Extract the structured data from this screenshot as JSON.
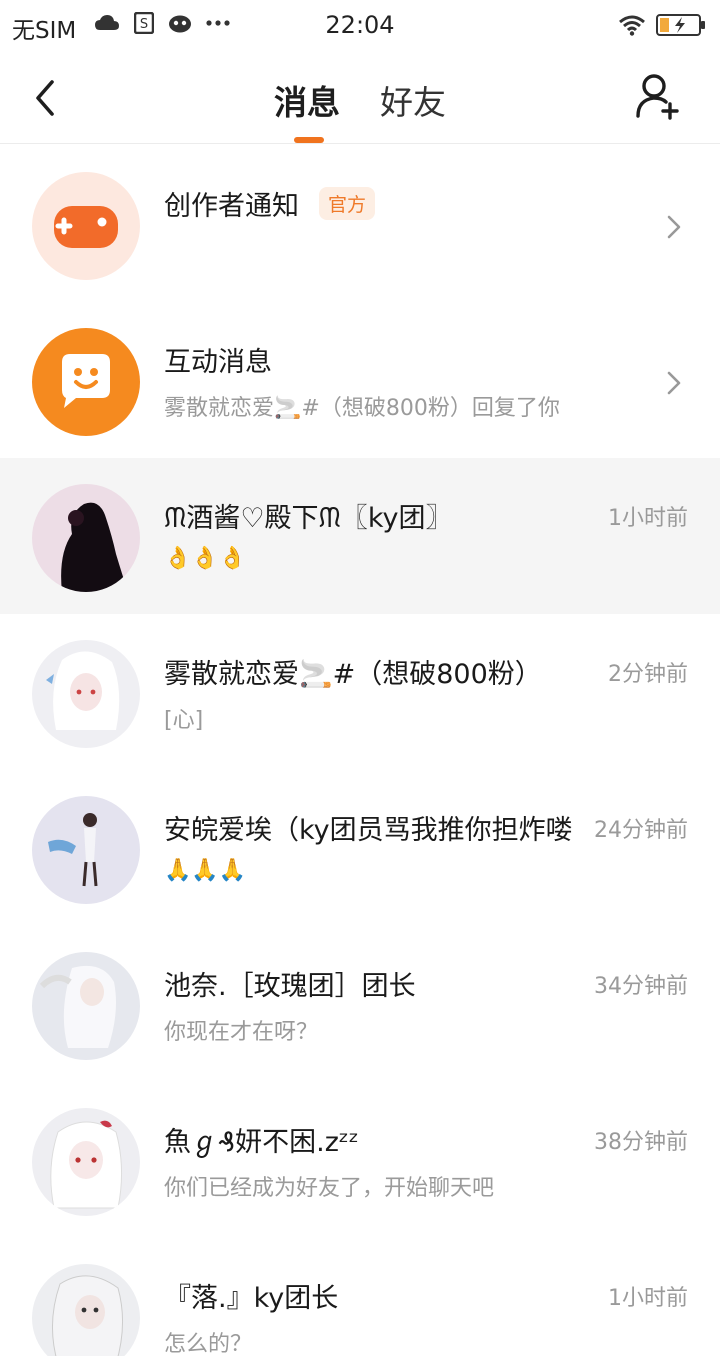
{
  "status_bar": {
    "carrier": "无SIM",
    "time": "22:04",
    "icons": [
      "cloud-icon",
      "sim-tool-icon",
      "app-icon",
      "more-dots-icon",
      "wifi-icon",
      "battery-charging-icon"
    ]
  },
  "header": {
    "tabs": [
      {
        "label": "消息",
        "active": true
      },
      {
        "label": "好友",
        "active": false
      }
    ]
  },
  "list": [
    {
      "title": "创作者通知",
      "badge": "官方",
      "subtitle": "",
      "time": "",
      "avatar": "gamepad-icon",
      "chevron": true,
      "highlighted": false
    },
    {
      "title": "互动消息",
      "badge": "",
      "subtitle": "雾散就恋爱🚬#（想破800粉）回复了你",
      "time": "",
      "avatar": "chat-smile-icon",
      "chevron": true,
      "highlighted": false
    },
    {
      "title": "ᙏ酒酱♡殿下ᙏ〖ky团〗",
      "badge": "",
      "subtitle": "👌👌👌",
      "time": "1小时前",
      "avatar": "user-avatar",
      "chevron": false,
      "highlighted": true
    },
    {
      "title": "雾散就恋爱🚬#（想破800粉）",
      "badge": "",
      "subtitle": "[心]",
      "time": "2分钟前",
      "avatar": "user-avatar",
      "chevron": false,
      "highlighted": false
    },
    {
      "title": "安皖爱埃（ky团员骂我推你担炸喽",
      "badge": "",
      "subtitle": "🙏🙏🙏",
      "time": "24分钟前",
      "avatar": "user-avatar",
      "chevron": false,
      "highlighted": false
    },
    {
      "title": "池奈.［玫瑰团］团长",
      "badge": "",
      "subtitle": "你现在才在呀？",
      "time": "34分钟前",
      "avatar": "user-avatar",
      "chevron": false,
      "highlighted": false
    },
    {
      "title": "魚ℊ₰妍不困.zᶻᶻ",
      "badge": "",
      "subtitle": "你们已经成为好友了，开始聊天吧",
      "time": "38分钟前",
      "avatar": "user-avatar",
      "chevron": false,
      "highlighted": false
    },
    {
      "title": "『落.』ky团长",
      "badge": "",
      "subtitle": "怎么的？",
      "time": "1小时前",
      "avatar": "user-avatar",
      "chevron": false,
      "highlighted": false
    }
  ],
  "colors": {
    "accent": "#f0731e",
    "badge_bg": "#fdeee3",
    "highlight_row": "#f5f5f5"
  }
}
